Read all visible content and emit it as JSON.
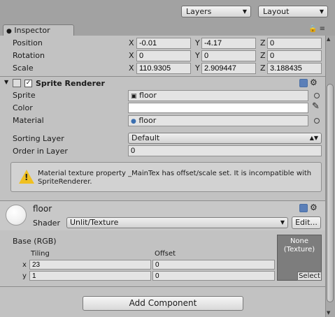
{
  "toolbar": {
    "layers_label": "Layers",
    "layout_label": "Layout"
  },
  "inspector": {
    "tab_label": "Inspector",
    "transform": {
      "position": {
        "label": "Position",
        "x": "-0.01",
        "y": "-4.17",
        "z": "0"
      },
      "rotation": {
        "label": "Rotation",
        "x": "0",
        "y": "0",
        "z": "0"
      },
      "scale": {
        "label": "Scale",
        "x": "110.9305",
        "y": "2.909447",
        "z": "3.188435"
      },
      "axis_x": "X",
      "axis_y": "Y",
      "axis_z": "Z"
    },
    "sprite_renderer": {
      "title": "Sprite Renderer",
      "enabled": true,
      "sprite_label": "Sprite",
      "sprite_value": "floor",
      "color_label": "Color",
      "color_value": "#ffffff",
      "material_label": "Material",
      "material_value": "floor",
      "sorting_layer_label": "Sorting Layer",
      "sorting_layer_value": "Default",
      "order_label": "Order in Layer",
      "order_value": "0",
      "warning": "Material texture property _MainTex has offset/scale set. It is incompatible with SpriteRenderer."
    },
    "material": {
      "name": "floor",
      "shader_label": "Shader",
      "shader_value": "Unlit/Texture",
      "edit_label": "Edit...",
      "base_label": "Base (RGB)",
      "tiling_label": "Tiling",
      "offset_label": "Offset",
      "x_label": "x",
      "y_label": "y",
      "tiling_x": "23",
      "tiling_y": "1",
      "offset_x": "0",
      "offset_y": "0",
      "texture_none": "None",
      "texture_type": "(Texture)",
      "select_label": "Select"
    },
    "add_component_label": "Add Component"
  },
  "colors": {
    "panel_bg": "#c2c2c2",
    "warning_icon": "#f0c020",
    "texture_slot": "#7d7d7d"
  }
}
